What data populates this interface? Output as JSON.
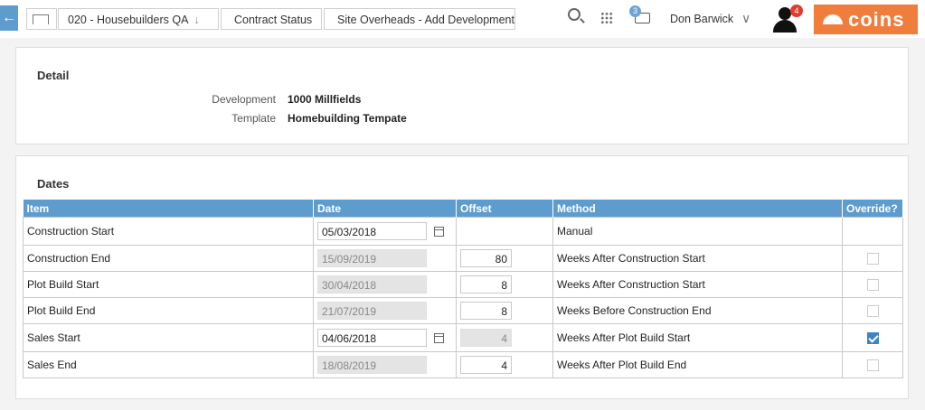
{
  "breadcrumbs": [
    {
      "label": "020 - Housebuilders QA"
    },
    {
      "label": "Contract Status"
    },
    {
      "label": "Site Overheads - Add Development"
    }
  ],
  "header": {
    "printer_badge": "3",
    "user_name": "Don Barwick",
    "notification_badge": "4",
    "logo_text": "coins"
  },
  "detail": {
    "title": "Detail",
    "development_label": "Development",
    "development_value": "1000 Millfields",
    "template_label": "Template",
    "template_value": "Homebuilding Tempate"
  },
  "dates": {
    "title": "Dates",
    "columns": [
      "Item",
      "Date",
      "Offset",
      "Method",
      "Override?"
    ],
    "rows": [
      {
        "item": "Construction Start",
        "date": "05/03/2018",
        "date_editable": true,
        "offset": "",
        "method": "Manual",
        "override": null
      },
      {
        "item": "Construction End",
        "date": "15/09/2019",
        "date_editable": false,
        "offset": "80",
        "offset_editable": true,
        "method": "Weeks After Construction Start",
        "override": false
      },
      {
        "item": "Plot Build Start",
        "date": "30/04/2018",
        "date_editable": false,
        "offset": "8",
        "offset_editable": true,
        "method": "Weeks After Construction Start",
        "override": false
      },
      {
        "item": "Plot Build End",
        "date": "21/07/2019",
        "date_editable": false,
        "offset": "8",
        "offset_editable": true,
        "method": "Weeks Before Construction End",
        "override": false
      },
      {
        "item": "Sales Start",
        "date": "04/06/2018",
        "date_editable": true,
        "offset": "4",
        "offset_editable": false,
        "method": "Weeks After Plot Build Start",
        "override": true
      },
      {
        "item": "Sales End",
        "date": "18/08/2019",
        "date_editable": false,
        "offset": "4",
        "offset_editable": true,
        "method": "Weeks After Plot Build End",
        "override": false
      }
    ]
  }
}
